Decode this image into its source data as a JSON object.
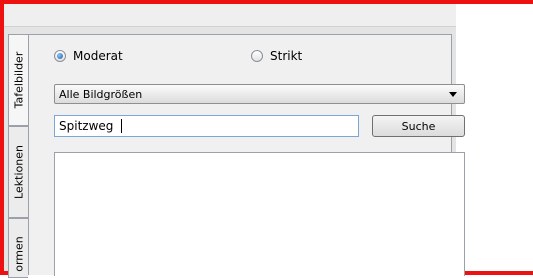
{
  "tabs": [
    {
      "label": "Tafelbilder"
    },
    {
      "label": "Lektionen"
    },
    {
      "label": "ormen"
    }
  ],
  "safesearch": {
    "options": [
      {
        "label": "Moderat",
        "checked": true
      },
      {
        "label": "Strikt",
        "checked": false
      }
    ]
  },
  "size_filter": {
    "selected": "Alle Bildgrößen"
  },
  "search": {
    "value": "Spitzweg",
    "button_label": "Suche"
  },
  "colors": {
    "frame": "#ee1111",
    "panel": "#f0f0f0",
    "input_focus_border": "#7aa7d8"
  }
}
